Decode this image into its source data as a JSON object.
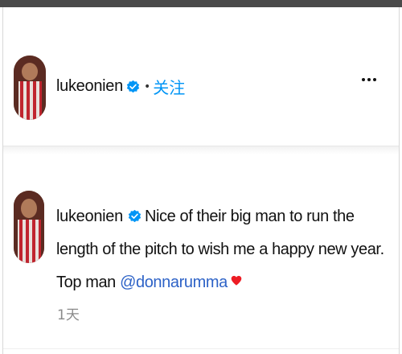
{
  "colors": {
    "follow": "#0095f6",
    "mention": "#2e63c7",
    "verified": "#0095f6",
    "heart": "#ed1c24",
    "timestamp": "#8a8a8a"
  },
  "header": {
    "username": "lukeonien",
    "verified_icon": "verified-badge-icon",
    "separator": "•",
    "follow_label": "关注",
    "more_icon": "more-options-icon"
  },
  "comment": {
    "username": "lukeonien",
    "verified_icon": "verified-badge-icon",
    "text_before_mention": "Nice of their big man to run the length of the pitch to wish me a happy new year. Top man ",
    "mention": "@donnarumma",
    "emoji_icon": "red-heart-icon",
    "timestamp": "1天"
  }
}
